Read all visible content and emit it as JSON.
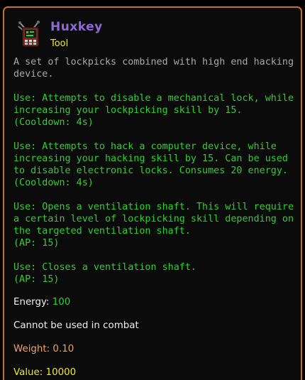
{
  "item": {
    "name": "Huxkey",
    "type": "Tool",
    "icon": "lockpick-device-icon",
    "description": "A set of lockpicks combined with high end hacking device.",
    "uses": [
      {
        "text": "Use: Attempts to disable a mechanical lock, while increasing your lockpicking skill by 15.",
        "meta": "(Cooldown: 4s)"
      },
      {
        "text": "Use: Attempts to hack a computer device, while increasing your hacking skill by 15. Can be used to disable electronic locks. Consumes 20 energy.",
        "meta": "(Cooldown: 4s)"
      },
      {
        "text": "Use: Opens a ventilation shaft. This will require a certain level of lockpicking skill depending on the targeted ventilation shaft.",
        "meta": "(AP: 15)"
      },
      {
        "text": "Use: Closes a ventilation shaft.",
        "meta": "(AP: 15)"
      }
    ],
    "energy_label": "Energy: ",
    "energy_value": "100",
    "combat_note": "Cannot be used in combat",
    "weight_label": "Weight: ",
    "weight_value": "0.10",
    "value_label": "Value: ",
    "value_value": "10000"
  },
  "colors": {
    "border": "#c4702f",
    "name": "#8c6ad8",
    "type": "#f1e72a",
    "use": "#2fd02f",
    "weight": "#e6a56b"
  }
}
